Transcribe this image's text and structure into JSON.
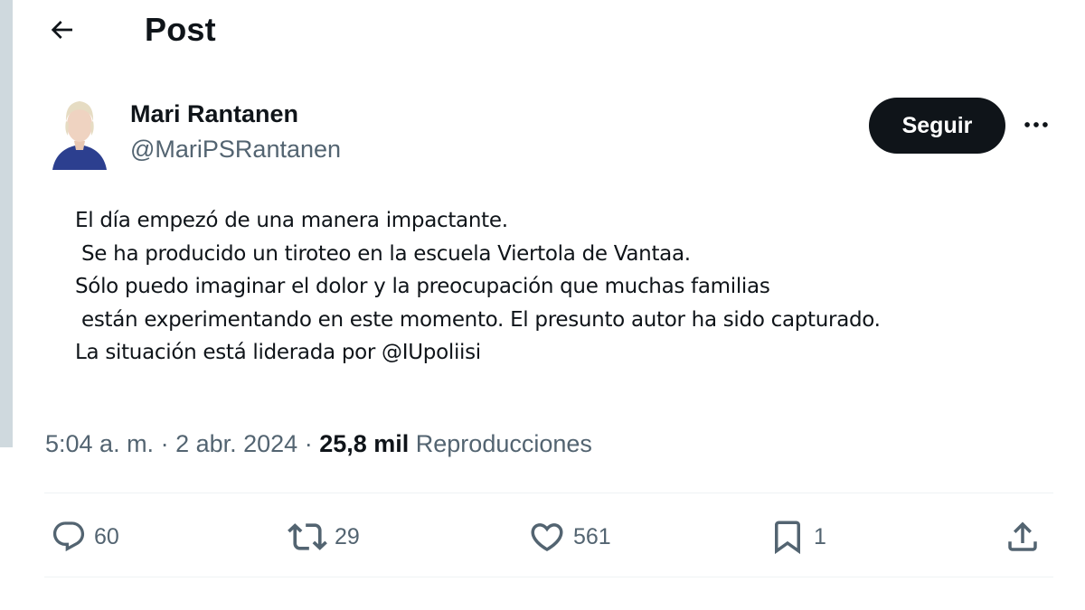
{
  "header": {
    "title": "Post",
    "back_icon": "arrow-left-icon"
  },
  "author": {
    "name": "Mari Rantanen",
    "handle": "@MariPSRantanen",
    "avatar_icon": "user-avatar"
  },
  "follow_label": "Seguir",
  "more_icon": "ellipsis-icon",
  "post": {
    "lines": [
      "El día empezó de una manera impactante.",
      " Se ha producido un tiroteo en la escuela Viertola de Vantaa.",
      "Sólo puedo imaginar el dolor y la preocupación que muchas familias",
      " están experimentando en este momento. El presunto autor ha sido capturado.",
      "La situación está liderada por @IUpoliisi"
    ]
  },
  "meta": {
    "time": "5:04 a. m.",
    "separator": " · ",
    "date": "2 abr. 2024",
    "views_count": "25,8 mil",
    "views_label": "Reproducciones"
  },
  "actions": {
    "replies": "60",
    "reposts": "29",
    "likes": "561",
    "bookmarks": "1"
  },
  "colors": {
    "text": "#0f1419",
    "secondary": "#536471",
    "divider": "#eff3f4",
    "button_bg": "#0f1419",
    "rail": "#cfd9de"
  }
}
